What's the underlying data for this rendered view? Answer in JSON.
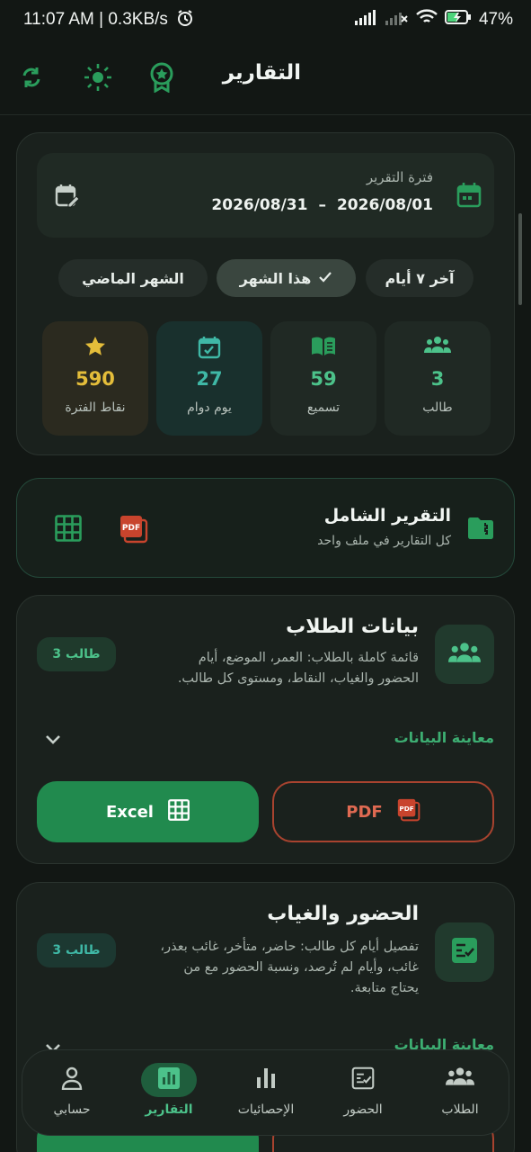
{
  "status_bar": {
    "time_speed": "11:07 AM | 0.3KB/s",
    "battery": "47%"
  },
  "header": {
    "title": "التقارير"
  },
  "period": {
    "label": "فترة التقرير",
    "start": "2026/08/01",
    "dash": "–",
    "end": "2026/08/31"
  },
  "filters": {
    "last7": "آخر ٧ أيام",
    "this_month": "هذا الشهر",
    "last_month": "الشهر الماضي"
  },
  "stats": [
    {
      "value": "3",
      "label": "طالب",
      "color": "#4cc28a"
    },
    {
      "value": "59",
      "label": "تسميع",
      "color": "#4cc28a"
    },
    {
      "value": "27",
      "label": "يوم دوام",
      "color": "#3fb8a6"
    },
    {
      "value": "590",
      "label": "نقاط الفترة",
      "color": "#e4bd3a"
    }
  ],
  "comprehensive": {
    "title": "التقرير الشامل",
    "subtitle": "كل التقارير في ملف واحد"
  },
  "students_section": {
    "title": "بيانات الطلاب",
    "badge": "3 طالب",
    "desc_line1": "قائمة كاملة بالطلاب: العمر، الموضع، أيام",
    "desc_line2": "الحضور والغياب، النقاط، ومستوى كل طالب.",
    "preview": "معاينة البيانات",
    "excel": "Excel",
    "pdf": "PDF"
  },
  "attendance_section": {
    "title": "الحضور والغياب",
    "badge": "3 طالب",
    "desc_line1": "تفصيل أيام كل طالب: حاضر، متأخر، غائب بعذر،",
    "desc_line2": "غائب، وأيام لم تُرصد، ونسبة الحضور مع من",
    "desc_line3": "يحتاج متابعة.",
    "preview": "معاينة البيانات"
  },
  "nav": {
    "students": "الطلاب",
    "attendance": "الحضور",
    "statistics": "الإحصائيات",
    "reports": "التقارير",
    "account": "حسابي"
  },
  "colors": {
    "accent": "#2a9d5c",
    "gold": "#e4bd3a",
    "teal": "#3fb8a6",
    "pdf_red": "#c8442d"
  }
}
